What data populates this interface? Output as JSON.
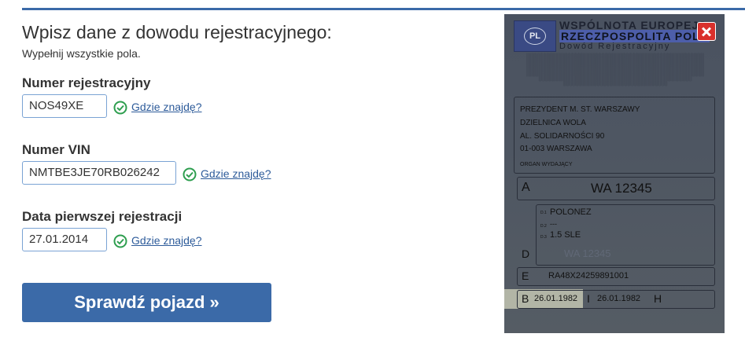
{
  "form": {
    "title": "Wpisz dane z dowodu rejestracyjnego:",
    "subtitle": "Wypełnij wszystkie pola.",
    "fields": [
      {
        "label": "Numer rejestracyjny",
        "value": "NOS49XE",
        "help": "Gdzie znajdę?"
      },
      {
        "label": "Numer VIN",
        "value": "NMTBE3JE70RB026242",
        "help": "Gdzie znajdę?"
      },
      {
        "label": "Data pierwszej rejestracji",
        "value": "27.01.2014",
        "help": "Gdzie znajdę?"
      }
    ],
    "submit_label": "Sprawdź pojazd »"
  },
  "document": {
    "flag": "PL",
    "header1": "WSPÓLNOTA EUROPEJS",
    "header2": "RZECZPOSPOLITA POLS",
    "header3": "Dowód Rejestracyjny",
    "issuer_lines": [
      "PREZYDENT M. ST. WARSZAWY",
      "DZIELNICA WOLA",
      "AL. SOLIDARNOŚCI 90",
      "01-003 WARSZAWA"
    ],
    "issuer_label": "ORGAN WYDAJĄCY",
    "field_a_letter": "A",
    "field_a_value": "WA 12345",
    "d1_label": "D.1",
    "d1_value": "POLONEZ",
    "d2_label": "D.2",
    "d2_value": "---",
    "d3_label": "D.3",
    "d3_value": "1.5 SLE",
    "field_d_letter": "D",
    "field_d_faded": "WA 12345",
    "field_e_letter": "E",
    "field_e_value": "RA48X24259891001",
    "field_b_letter": "B",
    "field_b_value": "26.01.1982",
    "field_i_letter": "I",
    "field_i_value": "26.01.1982",
    "field_h_letter": "H"
  },
  "colors": {
    "accent": "#3b6aa8",
    "check": "#2e9e4f",
    "link": "#2d5b9a",
    "close": "#d9302c"
  },
  "icons": {
    "check": "check-circle-icon",
    "close": "close-icon"
  }
}
